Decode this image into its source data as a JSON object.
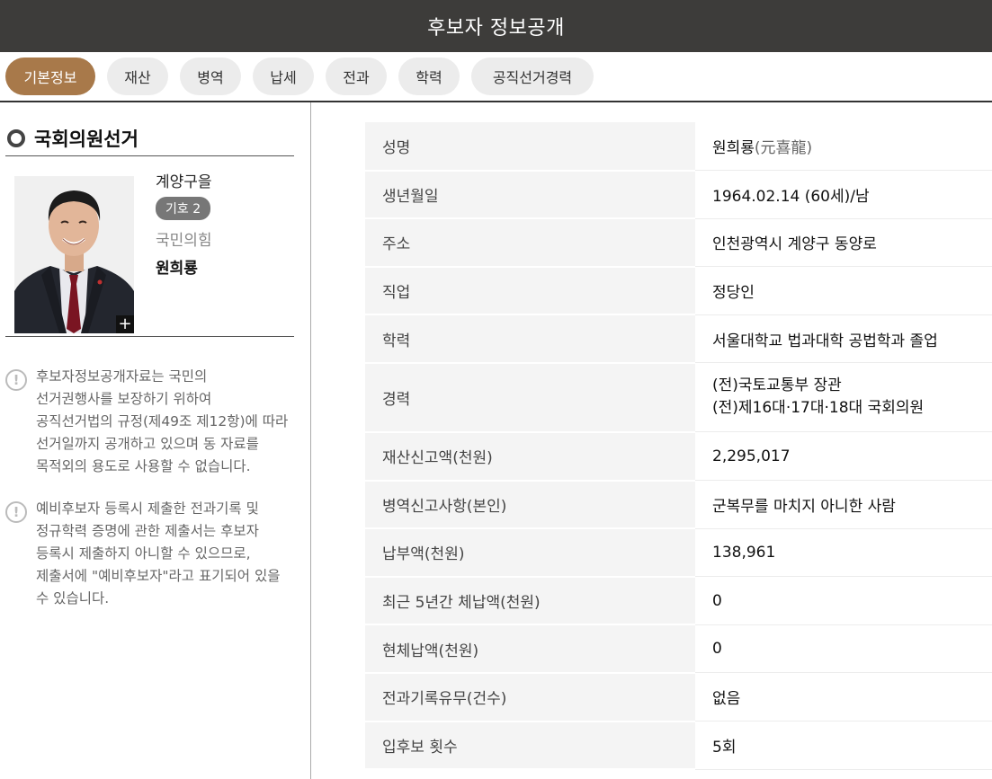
{
  "header": {
    "title": "후보자 정보공개"
  },
  "tabs": [
    {
      "label": "기본정보",
      "active": true
    },
    {
      "label": "재산",
      "active": false
    },
    {
      "label": "병역",
      "active": false
    },
    {
      "label": "납세",
      "active": false
    },
    {
      "label": "전과",
      "active": false
    },
    {
      "label": "학력",
      "active": false
    },
    {
      "label": "공직선거경력",
      "active": false
    }
  ],
  "sidebar": {
    "election_title": "국회의원선거",
    "candidate": {
      "district": "계양구을",
      "number_badge": "기호 2",
      "party": "국민의힘",
      "name": "원희룡",
      "zoom_symbol": "+"
    },
    "notices": [
      "후보자정보공개자료는 국민의 선거권행사를 보장하기 위하여 공직선거법의 규정(제49조 제12항)에 따라 선거일까지 공개하고 있으며 동 자료를 목적외의 용도로 사용할 수 없습니다.",
      "예비후보자 등록시 제출한 전과기록 및 정규학력 증명에 관한 제출서는 후보자 등록시 제출하지 아니할 수 있으므로, 제출서에 \"예비후보자\"라고 표기되어 있을 수 있습니다."
    ],
    "notice_lines": [
      [
        "후보자정보공개자료는 국민의",
        "선거권행사를 보장하기 위하여",
        "공직선거법의 규정(제49조 제12항)에 따라",
        "선거일까지 공개하고 있으며 동 자료를",
        "목적외의 용도로 사용할 수 없습니다."
      ],
      [
        "예비후보자 등록시 제출한 전과기록 및",
        "정규학력 증명에 관한 제출서는 후보자",
        "등록시 제출하지 아니할 수 있으므로,",
        "제출서에 \"예비후보자\"라고 표기되어 있을",
        "수 있습니다."
      ]
    ]
  },
  "info": {
    "name_label": "성명",
    "name_value": "원희룡",
    "name_hanja": "(元喜龍)",
    "birth_label": "생년월일",
    "birth_value": "1964.02.14 (60세)/남",
    "address_label": "주소",
    "address_value": "인천광역시 계양구 동양로",
    "job_label": "직업",
    "job_value": "정당인",
    "education_label": "학력",
    "education_value": "서울대학교 법과대학 공법학과 졸업",
    "career_label": "경력",
    "career_values": [
      "(전)국토교통부 장관",
      "(전)제16대·17대·18대 국회의원"
    ],
    "assets_label": "재산신고액(천원)",
    "assets_value": "2,295,017",
    "military_label": "병역신고사항(본인)",
    "military_value": "군복무를 마치지 아니한 사람",
    "tax_paid_label": "납부액(천원)",
    "tax_paid_value": "138,961",
    "tax_arrears_5y_label": "최근 5년간 체납액(천원)",
    "tax_arrears_5y_value": "0",
    "tax_arrears_now_label": "현체납액(천원)",
    "tax_arrears_now_value": "0",
    "criminal_label": "전과기록유무(건수)",
    "criminal_value": "없음",
    "runs_label": "입후보 횟수",
    "runs_value": "5회"
  },
  "colors": {
    "header_bg": "#3d3c3a",
    "tab_active": "#a8794a",
    "tab_inactive": "#ececec",
    "label_bg": "#f4f4f4",
    "badge_bg": "#777777"
  }
}
